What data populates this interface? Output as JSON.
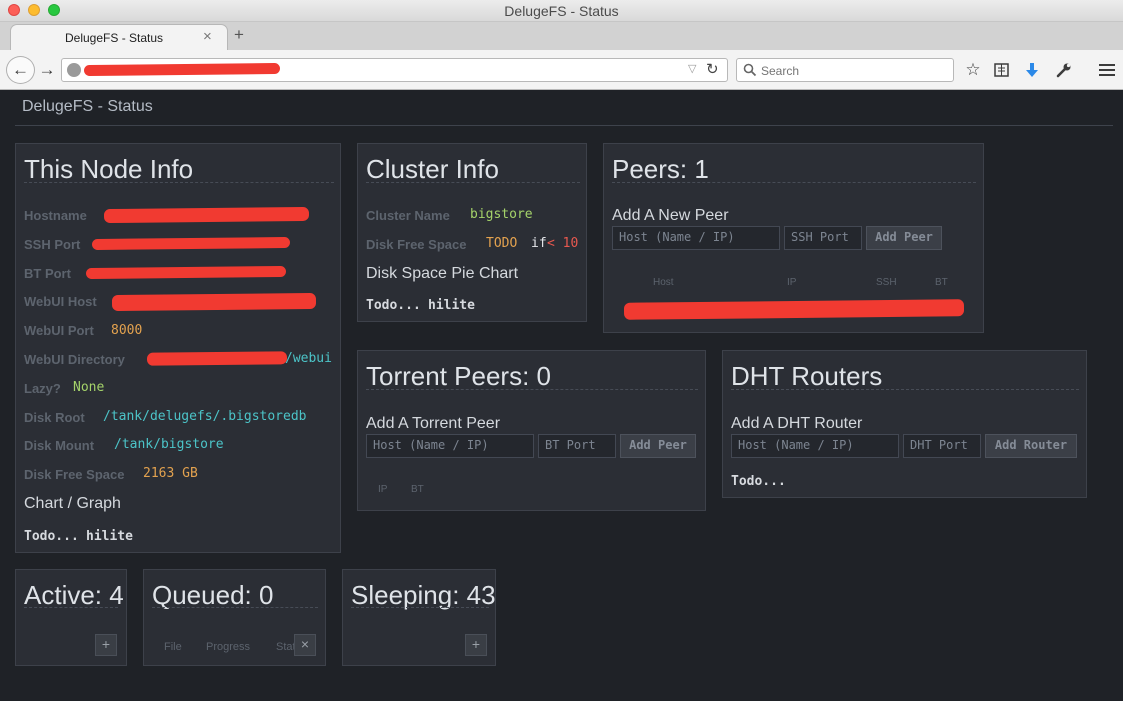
{
  "window": {
    "title": "DelugeFS - Status"
  },
  "tabs": [
    {
      "title": "DelugeFS - Status",
      "close": "×"
    }
  ],
  "new_tab": "+",
  "nav": {
    "back": "←",
    "forward": "→",
    "reload": "↻",
    "url_dropdown": "▽",
    "search_placeholder": "Search"
  },
  "toolbar_icons": [
    "star-icon",
    "reading-list-icon",
    "download-icon",
    "wrench-icon",
    "menu-icon"
  ],
  "page": {
    "brand": "DelugeFS - Status"
  },
  "node_info": {
    "title": "This Node Info",
    "rows": [
      {
        "label": "Hostname",
        "value": ""
      },
      {
        "label": "SSH Port",
        "value": ""
      },
      {
        "label": "BT Port",
        "value": ""
      },
      {
        "label": "WebUI Host",
        "value": ""
      },
      {
        "label": "WebUI Port",
        "value": "8000"
      },
      {
        "label": "WebUI Directory",
        "value": "/webui"
      },
      {
        "label": "Lazy?",
        "value": "None"
      },
      {
        "label": "Disk Root",
        "value": "/tank/delugefs/.bigstoredb"
      },
      {
        "label": "Disk Mount",
        "value": "/tank/bigstore"
      },
      {
        "label": "Disk Free Space",
        "value": "2163 GB"
      }
    ],
    "chart_heading": "Chart / Graph",
    "todo": "Todo...",
    "hilite": "hilite"
  },
  "cluster_info": {
    "title": "Cluster Info",
    "cluster_name_label": "Cluster Name",
    "cluster_name": "bigstore",
    "disk_free_label": "Disk Free Space",
    "disk_free_todo": "TODO",
    "disk_free_if": "if",
    "disk_free_cond": "< 10",
    "pie_heading": "Disk Space Pie Chart",
    "todo": "Todo...",
    "hilite": "hilite"
  },
  "peers": {
    "title": "Peers: 1",
    "add_heading": "Add A New Peer",
    "host_placeholder": "Host (Name / IP)",
    "ssh_placeholder": "SSH Port",
    "add_button": "Add Peer",
    "columns": [
      "Host",
      "IP",
      "SSH",
      "BT"
    ]
  },
  "torrent_peers": {
    "title": "Torrent Peers: 0",
    "add_heading": "Add A Torrent Peer",
    "host_placeholder": "Host (Name / IP)",
    "bt_placeholder": "BT Port",
    "add_button": "Add Peer",
    "columns": [
      "IP",
      "BT"
    ]
  },
  "dht_routers": {
    "title": "DHT Routers",
    "add_heading": "Add A DHT Router",
    "host_placeholder": "Host (Name / IP)",
    "dht_placeholder": "DHT Port",
    "add_button": "Add Router",
    "todo": "Todo..."
  },
  "active": {
    "title": "Active: 4",
    "button": "+"
  },
  "queued": {
    "title": "Queued: 0",
    "columns": [
      "File",
      "Progress",
      "State"
    ],
    "button": "×"
  },
  "sleeping": {
    "title": "Sleeping: 43",
    "button": "+"
  },
  "colors": {
    "background": "#1f2227",
    "panel": "#2b2e35",
    "green": "#a5d36a",
    "orange": "#e3a24f",
    "cyan": "#4cc4c8",
    "red": "#e8584f",
    "purple": "#c371e0",
    "redaction": "#f13a31"
  }
}
